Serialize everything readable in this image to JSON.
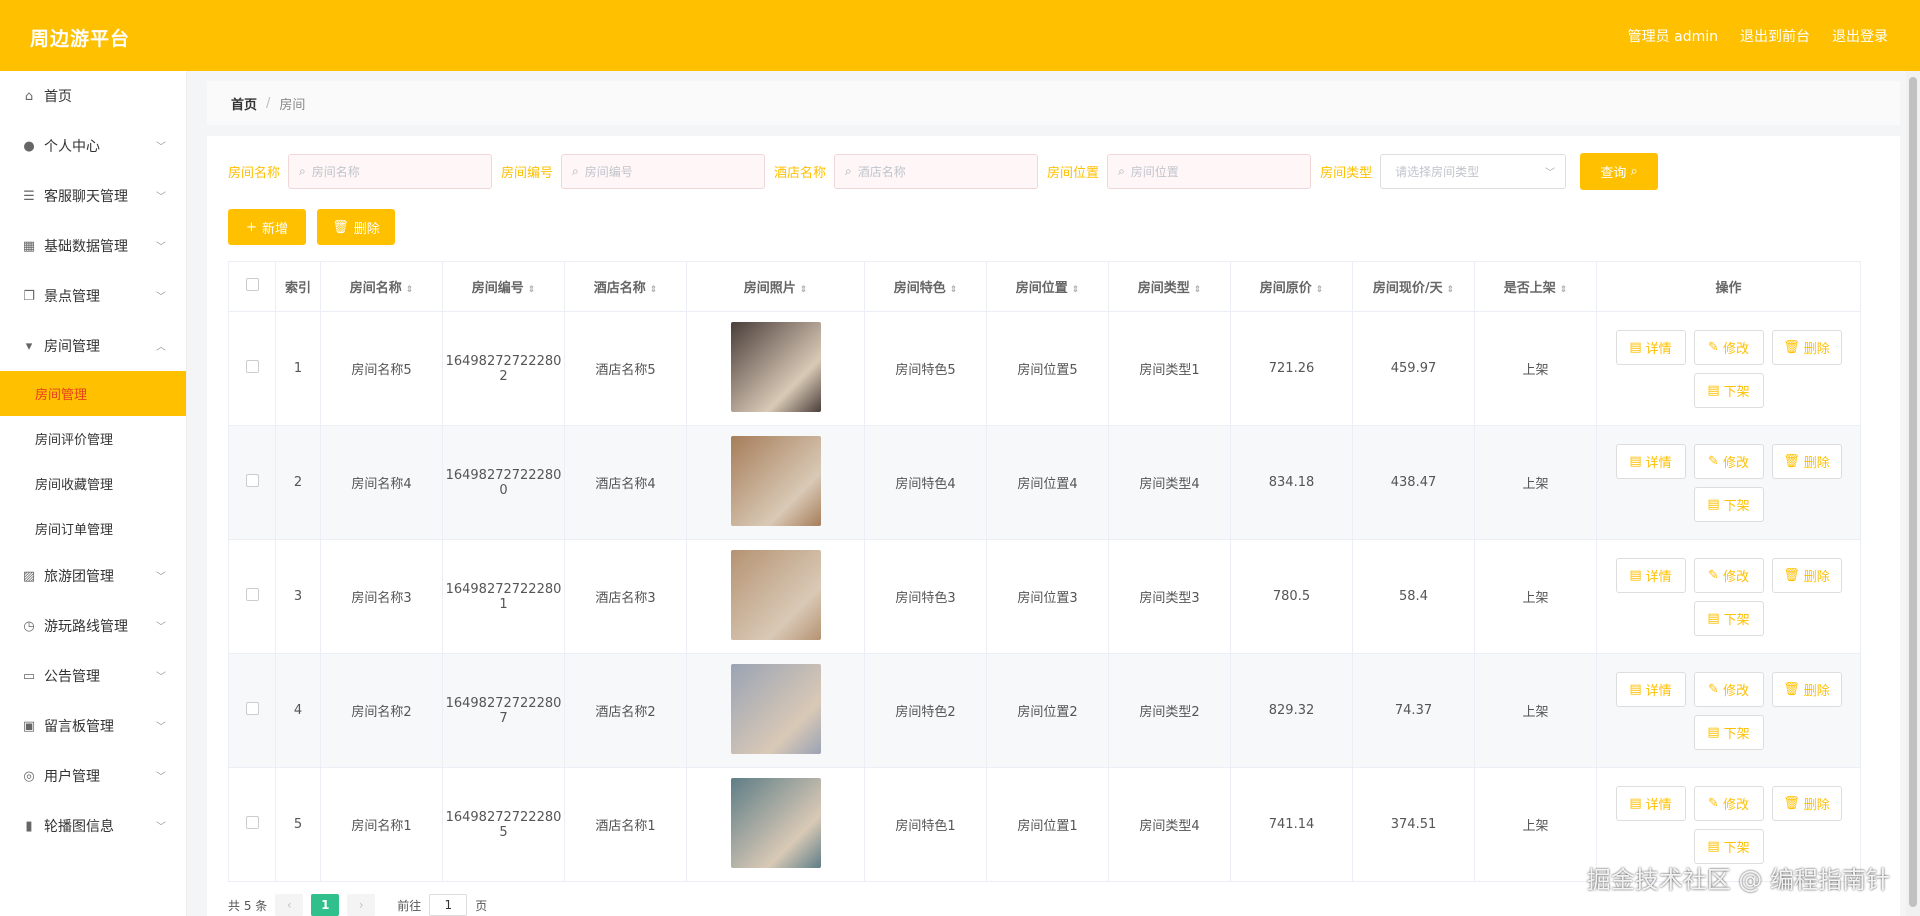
{
  "header": {
    "brand": "周边游平台",
    "user_label": "管理员 admin",
    "to_front": "退出到前台",
    "logout": "退出登录"
  },
  "sidebar": {
    "items": [
      {
        "label": "首页",
        "icon": "home-icon"
      },
      {
        "label": "个人中心",
        "icon": "user-icon"
      },
      {
        "label": "客服聊天管理",
        "icon": "list-icon"
      },
      {
        "label": "基础数据管理",
        "icon": "grid-icon"
      },
      {
        "label": "景点管理",
        "icon": "copy-icon"
      },
      {
        "label": "房间管理",
        "icon": "stamp-icon"
      },
      {
        "label": "旅游团管理",
        "icon": "chart-icon"
      },
      {
        "label": "游玩路线管理",
        "icon": "clock-icon"
      },
      {
        "label": "公告管理",
        "icon": "chat-icon"
      },
      {
        "label": "留言板管理",
        "icon": "message-icon"
      },
      {
        "label": "用户管理",
        "icon": "target-icon"
      },
      {
        "label": "轮播图信息",
        "icon": "bar-chart-icon"
      }
    ],
    "room_sub": [
      "房间管理",
      "房间评价管理",
      "房间收藏管理",
      "房间订单管理"
    ]
  },
  "breadcrumb": {
    "home": "首页",
    "sep": "/",
    "current": "房间"
  },
  "search": {
    "fields": [
      {
        "label": "房间名称",
        "placeholder": "房间名称"
      },
      {
        "label": "房间编号",
        "placeholder": "房间编号"
      },
      {
        "label": "酒店名称",
        "placeholder": "酒店名称"
      },
      {
        "label": "房间位置",
        "placeholder": "房间位置"
      }
    ],
    "type_label": "房间类型",
    "type_placeholder": "请选择房间类型",
    "query": "查询"
  },
  "actions": {
    "add": "新增",
    "delete": "删除"
  },
  "table": {
    "headers": [
      "索引",
      "房间名称",
      "房间编号",
      "酒店名称",
      "房间照片",
      "房间特色",
      "房间位置",
      "房间类型",
      "房间原价",
      "房间现价/天",
      "是否上架",
      "操作"
    ],
    "rows": [
      {
        "idx": "1",
        "name": "房间名称5",
        "code_a": "16498272722280",
        "code_b": "2",
        "hotel": "酒店名称5",
        "feature": "房间特色5",
        "location": "房间位置5",
        "type": "房间类型1",
        "orig": "721.26",
        "now": "459.97",
        "status": "上架",
        "photo_color": "#4a3e3a"
      },
      {
        "idx": "2",
        "name": "房间名称4",
        "code_a": "16498272722280",
        "code_b": "0",
        "hotel": "酒店名称4",
        "feature": "房间特色4",
        "location": "房间位置4",
        "type": "房间类型4",
        "orig": "834.18",
        "now": "438.47",
        "status": "上架",
        "photo_color": "#a67d5a"
      },
      {
        "idx": "3",
        "name": "房间名称3",
        "code_a": "16498272722280",
        "code_b": "1",
        "hotel": "酒店名称3",
        "feature": "房间特色3",
        "location": "房间位置3",
        "type": "房间类型3",
        "orig": "780.5",
        "now": "58.4",
        "status": "上架",
        "photo_color": "#b59372"
      },
      {
        "idx": "4",
        "name": "房间名称2",
        "code_a": "16498272722280",
        "code_b": "7",
        "hotel": "酒店名称2",
        "feature": "房间特色2",
        "location": "房间位置2",
        "type": "房间类型2",
        "orig": "829.32",
        "now": "74.37",
        "status": "上架",
        "photo_color": "#9aa3b4"
      },
      {
        "idx": "5",
        "name": "房间名称1",
        "code_a": "16498272722280",
        "code_b": "5",
        "hotel": "酒店名称1",
        "feature": "房间特色1",
        "location": "房间位置1",
        "type": "房间类型4",
        "orig": "741.14",
        "now": "374.51",
        "status": "上架",
        "photo_color": "#5e7d86"
      }
    ],
    "ops": {
      "detail": "详情",
      "edit": "修改",
      "delete": "删除",
      "offshelf": "下架"
    }
  },
  "pager": {
    "total": "共 5 条",
    "prev": "‹",
    "page": "1",
    "next": "›",
    "goto": "前往",
    "jump_value": "1",
    "unit": "页"
  },
  "watermark": "掘金技术社区 @ 编程指南针",
  "colors": {
    "accent": "#ffc000",
    "active_text": "#e6401f",
    "page_active": "#2fc08c"
  }
}
